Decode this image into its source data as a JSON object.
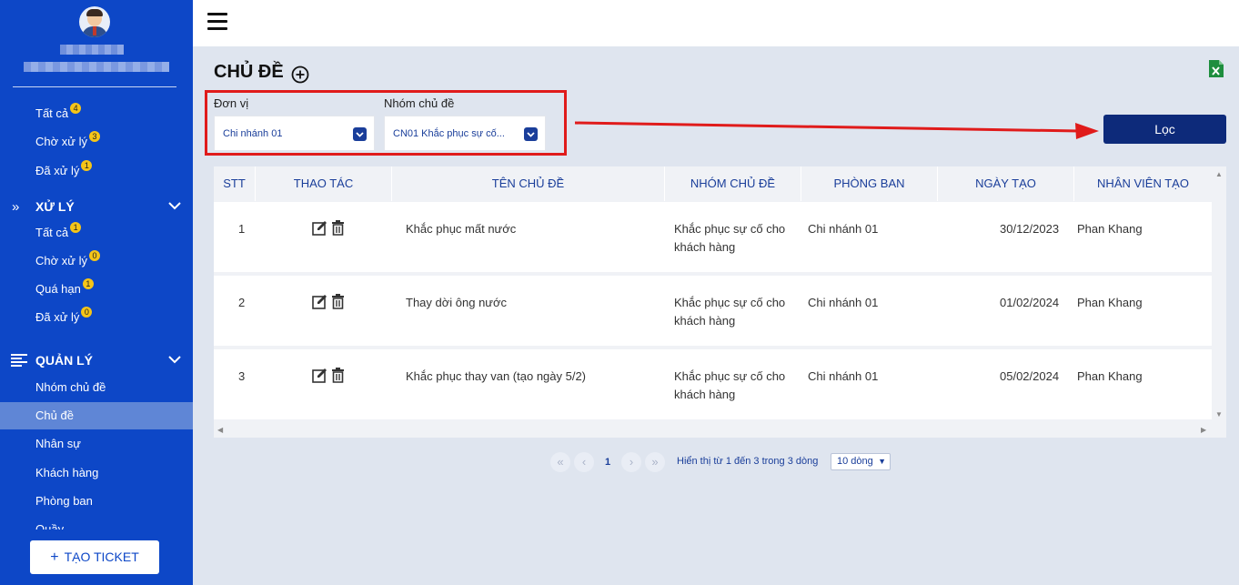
{
  "sidebar": {
    "group1": [
      {
        "label": "Tất cả",
        "badge": "4"
      },
      {
        "label": "Chờ xử lý",
        "badge": "3"
      },
      {
        "label": "Đã xử lý",
        "badge": "1"
      }
    ],
    "sections": [
      {
        "title": "XỬ LÝ",
        "icon": "double-chevron-right-icon"
      },
      {
        "title": "QUẢN LÝ",
        "icon": "list-icon"
      }
    ],
    "group2": [
      {
        "label": "Tất cả",
        "badge": "1"
      },
      {
        "label": "Chờ xử lý",
        "badge": "0"
      },
      {
        "label": "Quá hạn",
        "badge": "1"
      },
      {
        "label": "Đã xử lý",
        "badge": "0"
      }
    ],
    "group3": [
      {
        "label": "Nhóm chủ đề"
      },
      {
        "label": "Chủ đề",
        "active": true
      },
      {
        "label": "Nhân sự"
      },
      {
        "label": "Khách hàng"
      },
      {
        "label": "Phòng ban"
      },
      {
        "label": "Quầy"
      }
    ],
    "create_button": "TẠO TICKET"
  },
  "page": {
    "title": "CHỦ ĐỀ"
  },
  "filters": {
    "unit_label": "Đơn vị",
    "unit_value": "Chi nhánh 01",
    "group_label": "Nhóm chủ đề",
    "group_value": "CN01 Khắc phục sự cố...",
    "filter_button": "Lọc"
  },
  "table": {
    "headers": [
      "STT",
      "THAO TÁC",
      "TÊN CHỦ ĐỀ",
      "NHÓM CHỦ ĐỀ",
      "PHÒNG BAN",
      "NGÀY TẠO",
      "NHÂN VIÊN TẠO"
    ],
    "rows": [
      {
        "stt": "1",
        "name": "Khắc phục mất nước",
        "group_line1": "Khắc phục sự cố cho",
        "group_line2": "khách hàng",
        "dept": "Chi nhánh 01",
        "date": "30/12/2023",
        "creator": "Phan Khang"
      },
      {
        "stt": "2",
        "name": "Thay dời ông nước",
        "group_line1": "Khắc phục sự cố cho",
        "group_line2": "khách hàng",
        "dept": "Chi nhánh 01",
        "date": "01/02/2024",
        "creator": "Phan Khang"
      },
      {
        "stt": "3",
        "name": "Khắc phục thay van (tạo ngày 5/2)",
        "group_line1": "Khắc phục sự cố cho",
        "group_line2": "khách hàng",
        "dept": "Chi nhánh 01",
        "date": "05/02/2024",
        "creator": "Phan Khang"
      }
    ]
  },
  "pagination": {
    "first": "«",
    "prev": "‹",
    "current": "1",
    "next": "›",
    "last": "»",
    "info": "Hiển thị từ 1 đến 3 trong 3 dòng",
    "page_size": "10 dòng"
  }
}
